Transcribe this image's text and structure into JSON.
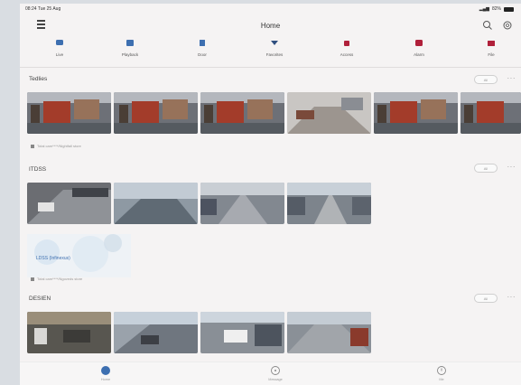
{
  "status_bar": {
    "time": "08:24",
    "date": "Tue 25 Aug",
    "battery": "82%"
  },
  "header": {
    "title": "Home"
  },
  "nav": [
    {
      "label": "Live",
      "icon": "camera-icon",
      "color": "#3d6fb0"
    },
    {
      "label": "Playback",
      "icon": "playback-icon",
      "color": "#3d6fb0"
    },
    {
      "label": "Door",
      "icon": "door-icon",
      "color": "#3d6fb0"
    },
    {
      "label": "Favorites",
      "icon": "favorites-icon",
      "color": "#2f4f7f"
    },
    {
      "label": "Access",
      "icon": "access-icon",
      "color": "#b0203a"
    },
    {
      "label": "Alarm",
      "icon": "alarm-icon",
      "color": "#b0203a"
    },
    {
      "label": "File",
      "icon": "file-icon",
      "color": "#b0203a"
    }
  ],
  "sections": [
    {
      "title": "Tedlies",
      "pill": "All",
      "caption": "Total cam****/Nightfall store"
    },
    {
      "title": "ITDSS",
      "pill": "All",
      "caption": "Total cam****/Ngoveds store",
      "map_label": "LDSS (Infinexus)"
    },
    {
      "title": "DESIEN",
      "pill": "All"
    }
  ],
  "bottom_tabs": [
    {
      "label": "Home",
      "active": true
    },
    {
      "label": "Message",
      "active": false
    },
    {
      "label": "Me",
      "active": false
    }
  ],
  "colors": {
    "accent": "#3d6fb0",
    "background": "#f5f3f3",
    "alert": "#b0203a"
  }
}
